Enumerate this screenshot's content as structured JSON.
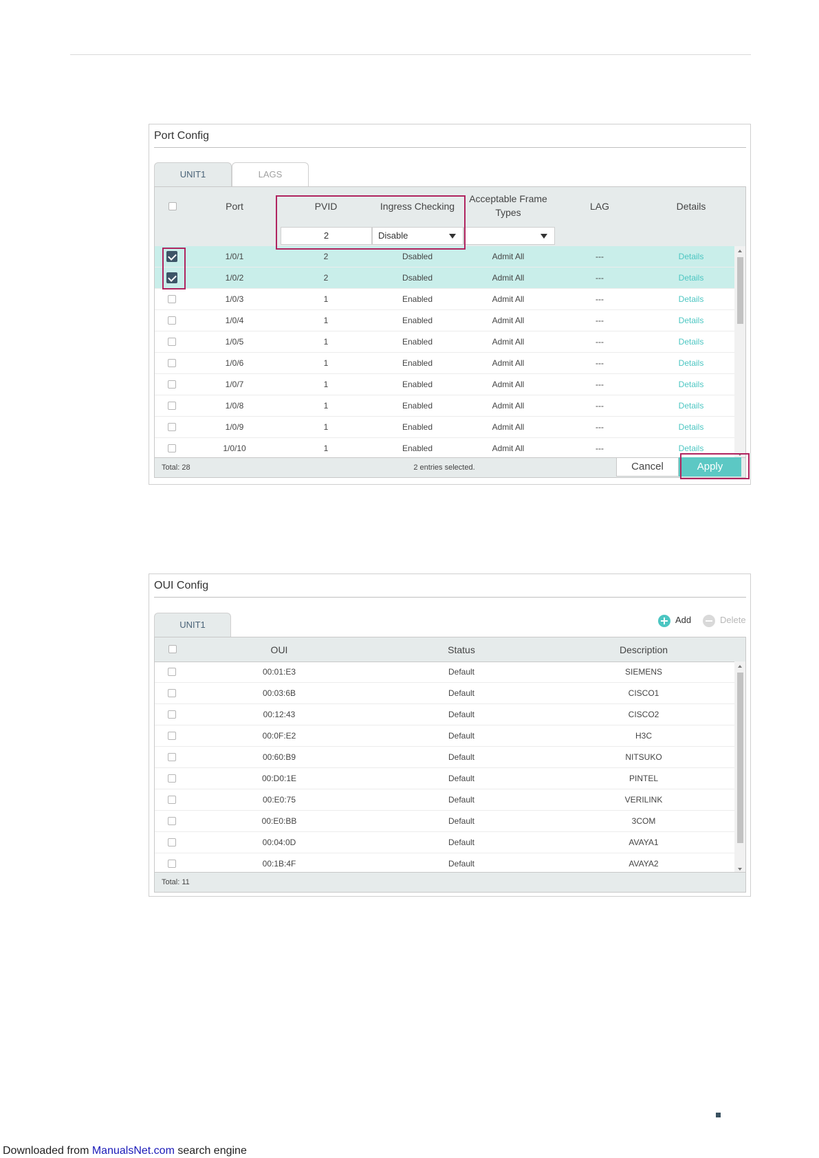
{
  "port_config": {
    "title": "Port Config",
    "tabs": [
      "UNIT1",
      "LAGS"
    ],
    "headers": {
      "port": "Port",
      "pvid": "PVID",
      "ingress": "Ingress Checking",
      "frame_line1": "Acceptable Frame",
      "frame_line2": "Types",
      "lag": "LAG",
      "details": "Details"
    },
    "filter": {
      "pvid_value": "2",
      "ingress_value": "Disable",
      "frame_value": ""
    },
    "rows": [
      {
        "checked": true,
        "port": "1/0/1",
        "pvid": "2",
        "ingress": "Dsabled",
        "frame": "Admit All",
        "lag": "---",
        "details": "Details"
      },
      {
        "checked": true,
        "port": "1/0/2",
        "pvid": "2",
        "ingress": "Dsabled",
        "frame": "Admit All",
        "lag": "---",
        "details": "Details"
      },
      {
        "checked": false,
        "port": "1/0/3",
        "pvid": "1",
        "ingress": "Enabled",
        "frame": "Admit All",
        "lag": "---",
        "details": "Details"
      },
      {
        "checked": false,
        "port": "1/0/4",
        "pvid": "1",
        "ingress": "Enabled",
        "frame": "Admit All",
        "lag": "---",
        "details": "Details"
      },
      {
        "checked": false,
        "port": "1/0/5",
        "pvid": "1",
        "ingress": "Enabled",
        "frame": "Admit All",
        "lag": "---",
        "details": "Details"
      },
      {
        "checked": false,
        "port": "1/0/6",
        "pvid": "1",
        "ingress": "Enabled",
        "frame": "Admit All",
        "lag": "---",
        "details": "Details"
      },
      {
        "checked": false,
        "port": "1/0/7",
        "pvid": "1",
        "ingress": "Enabled",
        "frame": "Admit All",
        "lag": "---",
        "details": "Details"
      },
      {
        "checked": false,
        "port": "1/0/8",
        "pvid": "1",
        "ingress": "Enabled",
        "frame": "Admit All",
        "lag": "---",
        "details": "Details"
      },
      {
        "checked": false,
        "port": "1/0/9",
        "pvid": "1",
        "ingress": "Enabled",
        "frame": "Admit All",
        "lag": "---",
        "details": "Details"
      },
      {
        "checked": false,
        "port": "1/0/10",
        "pvid": "1",
        "ingress": "Enabled",
        "frame": "Admit All",
        "lag": "---",
        "details": "Details"
      }
    ],
    "total": "Total: 28",
    "selected": "2 entries selected.",
    "cancel_label": "Cancel",
    "apply_label": "Apply"
  },
  "oui_config": {
    "title": "OUI Config",
    "tabs": [
      "UNIT1"
    ],
    "add_label": "Add",
    "delete_label": "Delete",
    "headers": {
      "oui": "OUI",
      "status": "Status",
      "description": "Description"
    },
    "rows": [
      {
        "oui": "00:01:E3",
        "status": "Default",
        "description": "SIEMENS"
      },
      {
        "oui": "00:03:6B",
        "status": "Default",
        "description": "CISCO1"
      },
      {
        "oui": "00:12:43",
        "status": "Default",
        "description": "CISCO2"
      },
      {
        "oui": "00:0F:E2",
        "status": "Default",
        "description": "H3C"
      },
      {
        "oui": "00:60:B9",
        "status": "Default",
        "description": "NITSUKO"
      },
      {
        "oui": "00:D0:1E",
        "status": "Default",
        "description": "PINTEL"
      },
      {
        "oui": "00:E0:75",
        "status": "Default",
        "description": "VERILINK"
      },
      {
        "oui": "00:E0:BB",
        "status": "Default",
        "description": "3COM"
      },
      {
        "oui": "00:04:0D",
        "status": "Default",
        "description": "AVAYA1"
      },
      {
        "oui": "00:1B:4F",
        "status": "Default",
        "description": "AVAYA2"
      }
    ],
    "total": "Total: 11"
  },
  "footer": {
    "prefix": "Downloaded from ",
    "site": "ManualsNet.com",
    "suffix": " search engine"
  },
  "colors": {
    "accent": "#5cc8c4",
    "highlight": "#b0245f",
    "selected_row": "#c9eeea",
    "header_bg": "#e6ebeb"
  }
}
